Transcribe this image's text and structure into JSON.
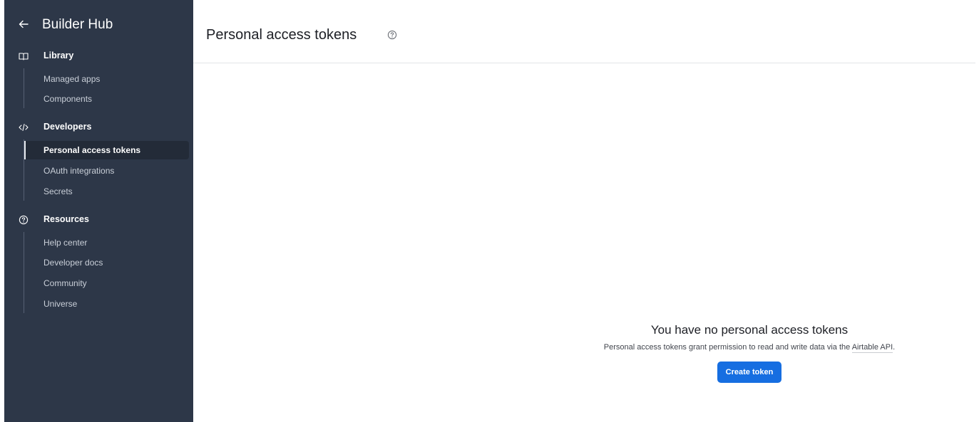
{
  "sidebar": {
    "title": "Builder Hub",
    "sections": [
      {
        "title": "Library",
        "icon": "book-icon",
        "items": [
          "Managed apps",
          "Components"
        ]
      },
      {
        "title": "Developers",
        "icon": "code-icon",
        "items": [
          "Personal access tokens",
          "OAuth integrations",
          "Secrets"
        ]
      },
      {
        "title": "Resources",
        "icon": "help-circle-icon",
        "items": [
          "Help center",
          "Developer docs",
          "Community",
          "Universe"
        ]
      }
    ],
    "active_item": "Personal access tokens"
  },
  "main": {
    "title": "Personal access tokens",
    "empty_state": {
      "title": "You have no personal access tokens",
      "description": "Personal access tokens grant permission to read and write data via the",
      "link": "Airtable API",
      "description_end": ".",
      "button": "Create token"
    }
  },
  "colors": {
    "sidebar_bg": "#2d3748",
    "accent": "#166ee1"
  }
}
